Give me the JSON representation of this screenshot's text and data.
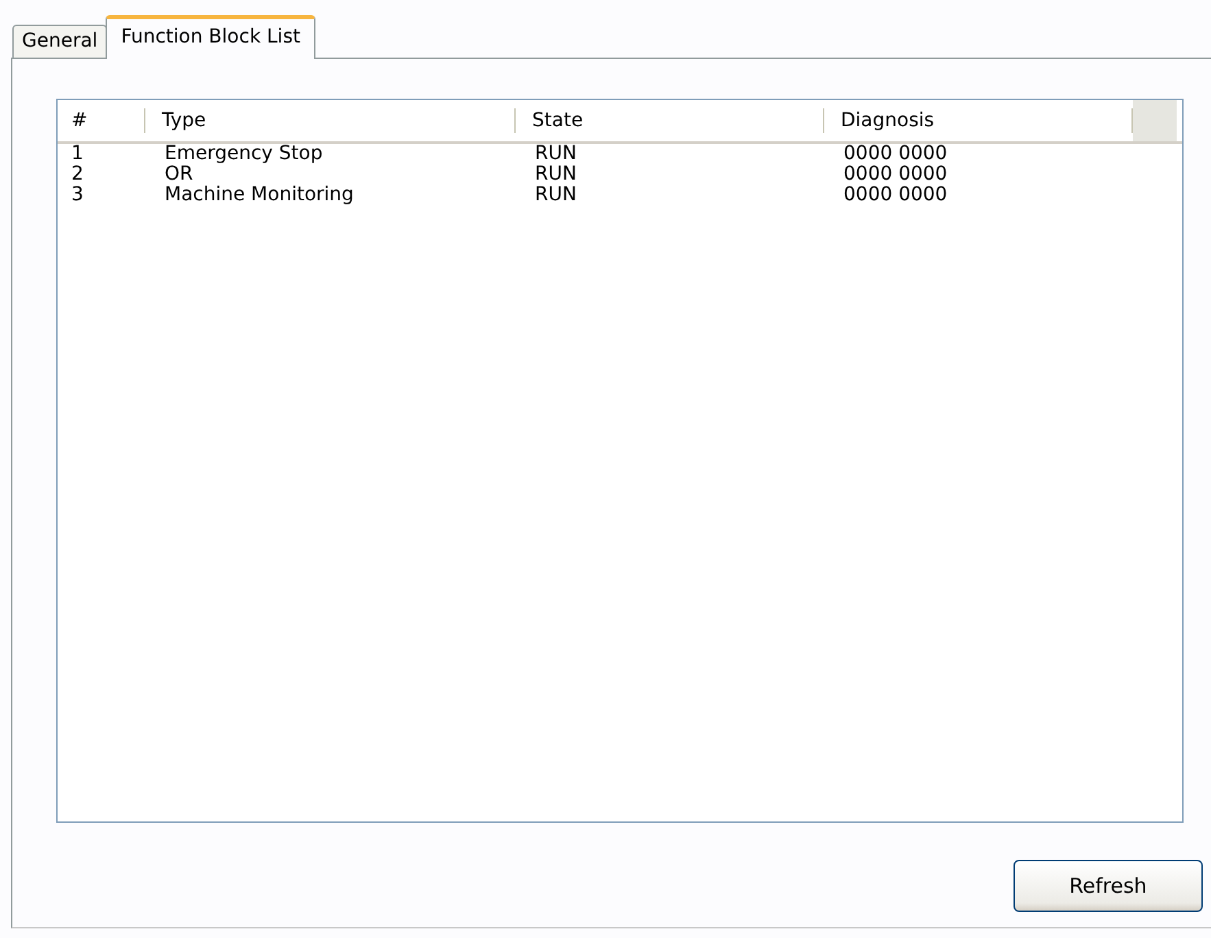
{
  "tabs": [
    {
      "label": "General",
      "selected": false
    },
    {
      "label": "Function Block List",
      "selected": true
    }
  ],
  "table": {
    "columns": [
      "#",
      "Type",
      "State",
      "Diagnosis"
    ],
    "rows": [
      {
        "cells": [
          "1",
          "Emergency Stop",
          "RUN",
          "0000 0000"
        ]
      },
      {
        "cells": [
          "2",
          "OR",
          "RUN",
          "0000 0000"
        ]
      },
      {
        "cells": [
          "3",
          "Machine Monitoring",
          "RUN",
          "0000 0000"
        ]
      }
    ]
  },
  "buttons": [
    "Refresh"
  ]
}
